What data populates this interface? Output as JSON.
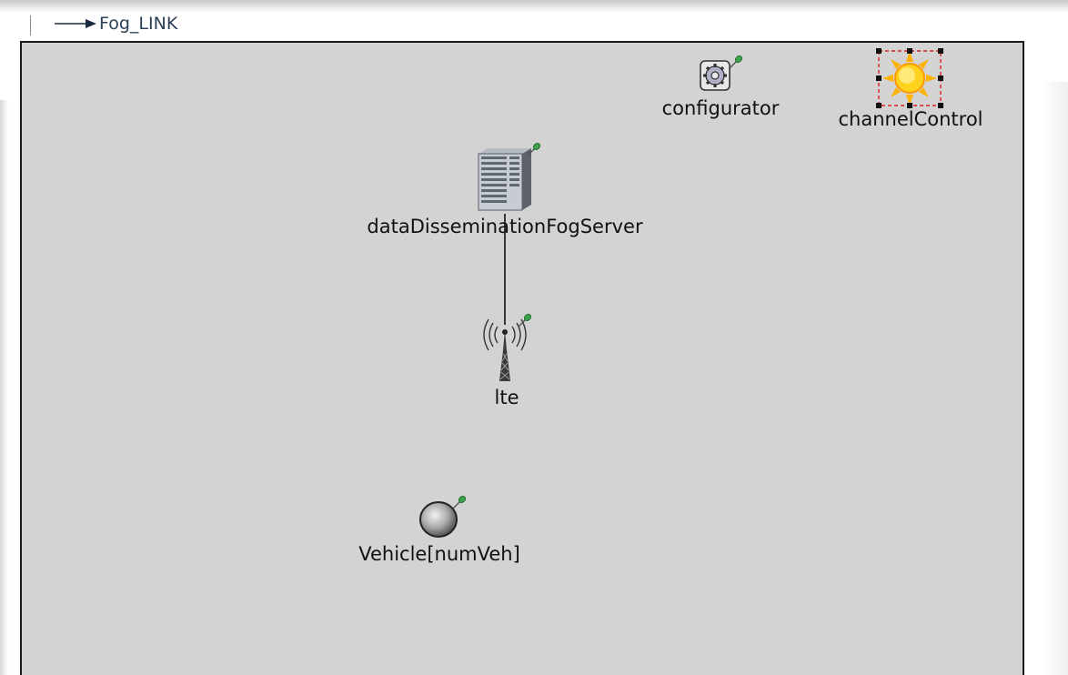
{
  "toolbar": {
    "link_label": "Fog_LINK",
    "link_icon": "arrow-right-icon"
  },
  "network": {
    "background_color": "#d3d3d3",
    "nodes": {
      "configurator": {
        "label": "configurator",
        "icon": "gear-icon"
      },
      "channelControl": {
        "label": "channelControl",
        "icon": "sun-icon",
        "selected": true
      },
      "server": {
        "label": "dataDisseminationFogServer",
        "icon": "server-icon"
      },
      "lte": {
        "label": "lte",
        "icon": "antenna-tower-icon"
      },
      "vehicle": {
        "label": "Vehicle[numVeh]",
        "icon": "sphere-icon"
      }
    },
    "connections": [
      {
        "from": "dataDisseminationFogServer",
        "to": "lte"
      }
    ],
    "colors": {
      "pin": "#3fa34d",
      "selection": "#e02020"
    }
  }
}
